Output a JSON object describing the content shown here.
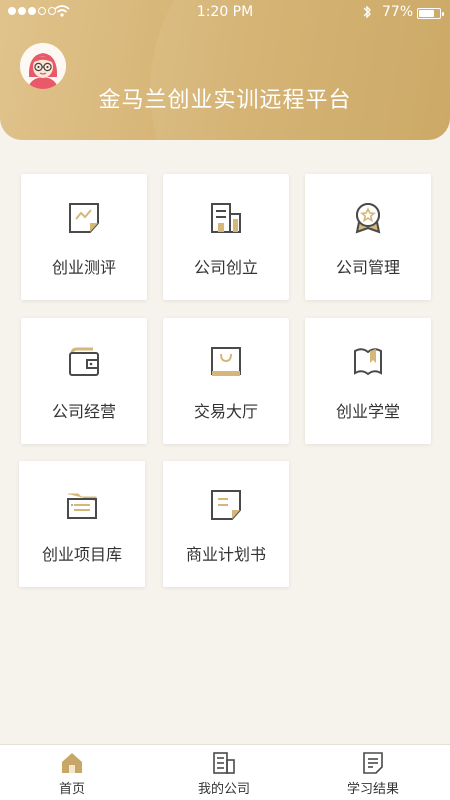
{
  "status_bar": {
    "time": "1:20 PM",
    "battery_text": "77%",
    "battery_level": 0.77,
    "signal_icon": "signal-dots-icon",
    "wifi_icon": "wifi-icon",
    "bluetooth_icon": "bluetooth-icon"
  },
  "header": {
    "title": "金马兰创业实训远程平台",
    "avatar_icon": "avatar-icon"
  },
  "colors": {
    "accent": "#d2ae6c",
    "icon_stroke": "#4a4a4a",
    "icon_fill": "#d6b77a",
    "background": "#f6f2ec"
  },
  "tiles": [
    {
      "label": "创业测评",
      "icon": "chart-document-icon"
    },
    {
      "label": "公司创立",
      "icon": "building-icon"
    },
    {
      "label": "公司管理",
      "icon": "award-badge-icon"
    },
    {
      "label": "公司经营",
      "icon": "wallet-icon"
    },
    {
      "label": "交易大厅",
      "icon": "shopping-bag-icon"
    },
    {
      "label": "创业学堂",
      "icon": "open-book-icon"
    },
    {
      "label": "创业项目库",
      "icon": "folder-icon"
    },
    {
      "label": "商业计划书",
      "icon": "document-icon"
    }
  ],
  "tabs": [
    {
      "label": "首页",
      "icon": "home-icon",
      "active": true
    },
    {
      "label": "我的公司",
      "icon": "company-icon",
      "active": false
    },
    {
      "label": "学习结果",
      "icon": "result-document-icon",
      "active": false
    }
  ]
}
